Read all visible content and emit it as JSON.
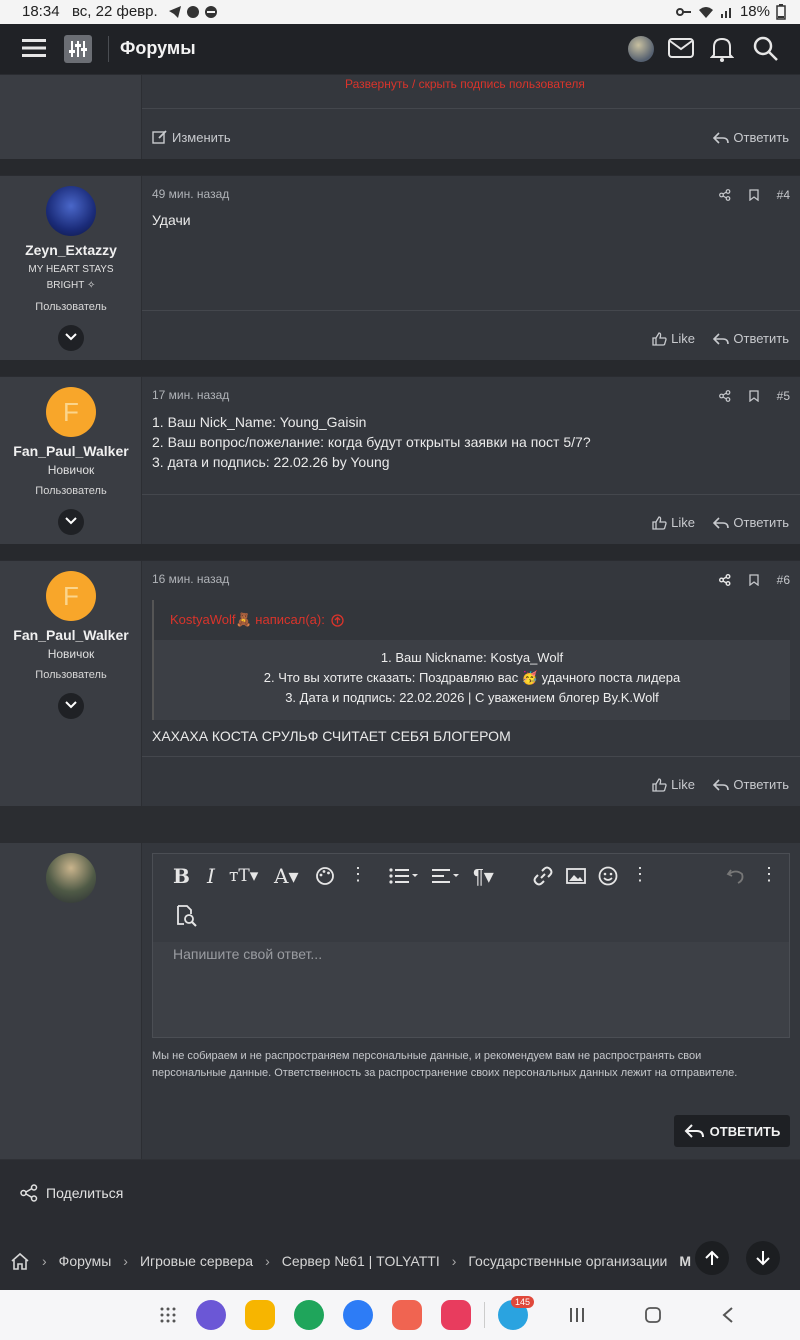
{
  "status_bar": {
    "time": "18:34",
    "date": "вс, 22 февр.",
    "battery": "18%"
  },
  "header": {
    "title": "Форумы"
  },
  "top_post": {
    "signature_toggle": "Развернуть / скрыть подпись пользователя",
    "edit_label": "Изменить",
    "reply_label": "Ответить"
  },
  "posts": [
    {
      "username": "Zeyn_Extazzy",
      "user_title_line1": "MY HEART STAYS",
      "user_title_line2": "BRIGHT ✧",
      "role": "Пользователь",
      "time": "49 мин. назад",
      "number": "#4",
      "lines": [
        "Удачи"
      ],
      "like": "Like",
      "reply": "Ответить"
    },
    {
      "avatar_letter": "F",
      "username": "Fan_Paul_Walker",
      "user_title": "Новичок",
      "role": "Пользователь",
      "time": "17 мин. назад",
      "number": "#5",
      "lines": [
        "1. Ваш Nick_Name: Young_Gaisin",
        "2. Ваш вопрос/пожелание: когда будут открыты заявки на пост 5/7?",
        "3. дата и подпись: 22.02.26 by Young"
      ],
      "like": "Like",
      "reply": "Ответить"
    },
    {
      "avatar_letter": "F",
      "username": "Fan_Paul_Walker",
      "user_title": "Новичок",
      "role": "Пользователь",
      "time": "16 мин. назад",
      "number": "#6",
      "quote": {
        "author": "KostyaWolf🧸 написал(а):",
        "line1": "1. Ваш Nickname: Kostya_Wolf",
        "line2": "2. Что вы хотите сказать: Поздравляю вас 🥳 удачного поста лидера",
        "line3": "3. Дата и подпись: 22.02.2026 | С уважением блогер By.K.Wolf"
      },
      "lines": [
        "ХАХАХА КОСТА СРУЛЬФ СЧИТАЕТ СЕБЯ БЛОГЕРОМ"
      ],
      "like": "Like",
      "reply": "Ответить"
    }
  ],
  "reply_box": {
    "placeholder": "Напишите свой ответ...",
    "disclaimer": "Мы не собираем и не распространяем персональные данные, и рекомендуем вам не распространять свои персональные данные. Ответственность за распространение своих персональных данных лежит на отправителе.",
    "submit_label": "ОТВЕТИТЬ"
  },
  "share": {
    "label": "Поделиться"
  },
  "breadcrumb": [
    "Форумы",
    "Игровые сервера",
    "Сервер №61 | TOLYATTI",
    "Государственные организации",
    "М"
  ],
  "nav": {
    "telegram_badge": "145"
  },
  "colors": {
    "accent_red": "#d9342b",
    "avatar_orange": "#f8a62a",
    "bg_dark": "#2f3136"
  }
}
